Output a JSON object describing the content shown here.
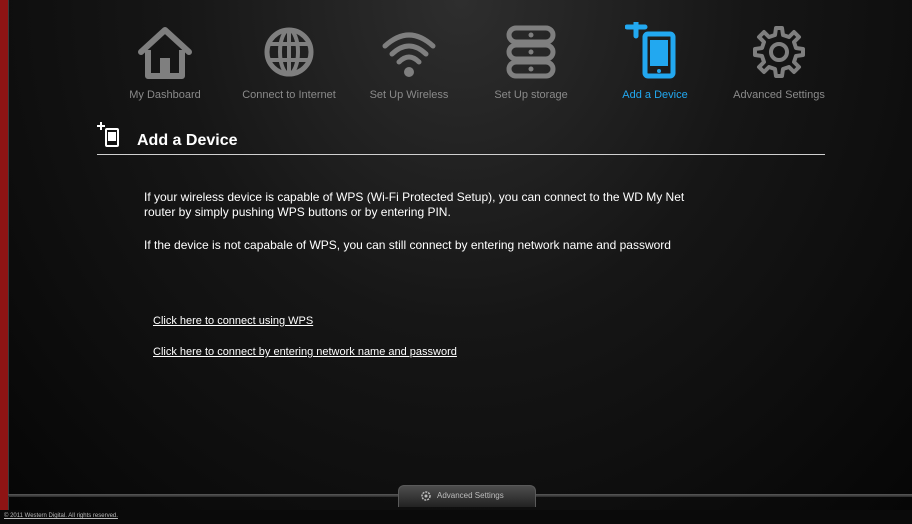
{
  "nav": {
    "items": [
      {
        "label": "My Dashboard",
        "icon": "house-icon"
      },
      {
        "label": "Connect to Internet",
        "icon": "globe-icon"
      },
      {
        "label": "Set Up Wireless",
        "icon": "wifi-icon"
      },
      {
        "label": "Set Up storage",
        "icon": "storage-icon"
      },
      {
        "label": "Add a Device",
        "icon": "add-device-icon",
        "active": true
      },
      {
        "label": "Advanced Settings",
        "icon": "gear-icon"
      }
    ]
  },
  "page": {
    "title": "Add a Device",
    "paragraph1": "If your wireless device is capable of WPS (Wi-Fi Protected Setup), you can connect to the WD My Net router by simply pushing WPS buttons or by entering PIN.",
    "paragraph2": "If the device is not capabale of WPS, you can still connect by entering network name and password",
    "link_wps": "Click here to connect using WPS",
    "link_manual": "Click here to connect by entering network name and password"
  },
  "bottom_tab": {
    "label": "Advanced Settings",
    "icon": "gear-icon"
  },
  "footer": {
    "copyright": "© 2011 Western Digital. All rights reserved."
  },
  "colors": {
    "accent": "#22a8f0",
    "icon_gray": "#7f7f7f",
    "frame_border": "#8e1414"
  }
}
